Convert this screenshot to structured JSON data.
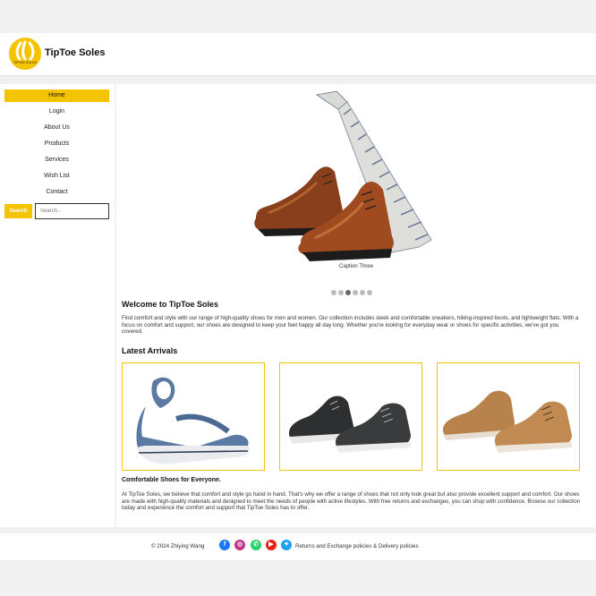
{
  "brand": {
    "name": "TipToe Soles",
    "logo_text": "TIPTOE SOLES"
  },
  "nav": {
    "items": [
      {
        "label": "Home",
        "active": true
      },
      {
        "label": "Login",
        "active": false
      },
      {
        "label": "About Us",
        "active": false
      },
      {
        "label": "Products",
        "active": false
      },
      {
        "label": "Services",
        "active": false
      },
      {
        "label": "Wish List",
        "active": false
      },
      {
        "label": "Contact",
        "active": false
      }
    ]
  },
  "search": {
    "button_label": "Search",
    "placeholder": "Search.."
  },
  "carousel": {
    "caption": "Caption Three",
    "slide_count": 6,
    "active_index": 2
  },
  "welcome": {
    "title": "Welcome to TipToe Soles",
    "text": "Find comfort and style with our range of high-quality shoes for men and women. Our collection includes sleek and comfortable sneakers, hiking-inspired boots, and lightweight flats. With a focus on comfort and support, our shoes are designed to keep your feet happy all day long. Whether you're looking for everyday wear or shoes for specific activities, we've got you covered."
  },
  "arrivals": {
    "title": "Latest Arrivals",
    "products": [
      {
        "name": "blue-sandal"
      },
      {
        "name": "black-sneakers"
      },
      {
        "name": "tan-lace-up-shoes"
      }
    ]
  },
  "comfort": {
    "title": "Comfortable Shoes for Everyone.",
    "text": "At TipToe Soles, we believe that comfort and style go hand in hand. That's why we offer a range of shoes that not only look great but also provide excellent support and comfort. Our shoes are made with high-quality materials and designed to meet the needs of people with active lifestyles. With free returns and exchanges, you can shop with confidence. Browse our collection today and experience the comfort and support that TipToe Soles has to offer."
  },
  "footer": {
    "copyright": "© 2024 Zhiying Wang",
    "policies": "Returns and Exchange policies & Delivery policies",
    "social": [
      {
        "icon": "facebook-icon",
        "color": "#1877f2",
        "glyph": "f"
      },
      {
        "icon": "instagram-icon",
        "color": "#c13584",
        "glyph": "◎"
      },
      {
        "icon": "whatsapp-icon",
        "color": "#25d366",
        "glyph": "✆"
      },
      {
        "icon": "youtube-icon",
        "color": "#e62117",
        "glyph": "▶"
      },
      {
        "icon": "twitter-icon",
        "color": "#1da1f2",
        "glyph": "✦"
      }
    ]
  },
  "colors": {
    "accent": "#f5c400",
    "background": "#f1f1f1"
  }
}
